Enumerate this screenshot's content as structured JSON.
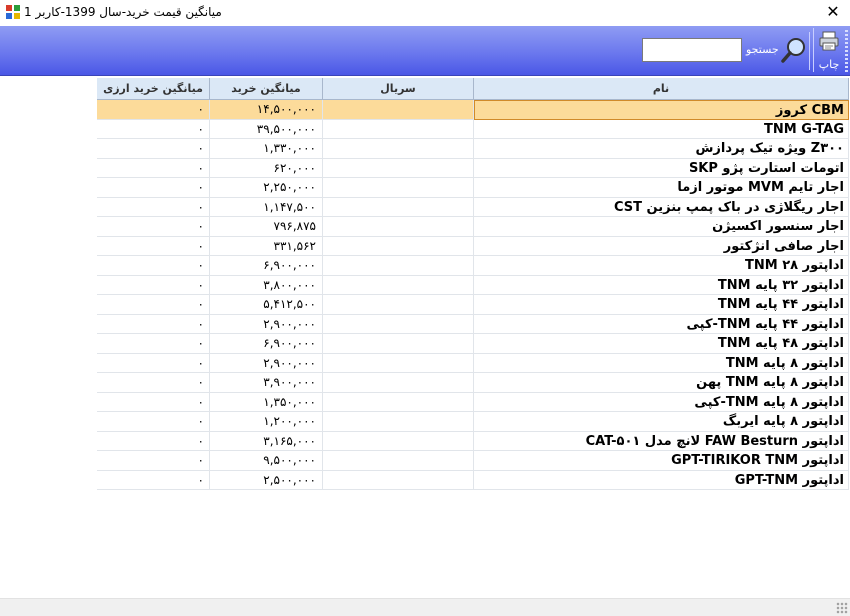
{
  "window": {
    "title": "میانگین قیمت خرید-سال 1399-کاربر 1",
    "close": "✕"
  },
  "toolbar": {
    "print_label": "چاپ",
    "search_label": "جستجو",
    "search_value": ""
  },
  "columns": {
    "name": "نام",
    "serial": "سریال",
    "avg_purchase": "میانگین خرید",
    "avg_fx": "میانگین خرید ارزی"
  },
  "rows": [
    {
      "name": "CBM کروز",
      "serial": "",
      "avg": "۱۴,۵۰۰,۰۰۰",
      "fx": "۰"
    },
    {
      "name": "TNM G-TAG",
      "serial": "",
      "avg": "۳۹,۵۰۰,۰۰۰",
      "fx": "۰"
    },
    {
      "name": "Z۳۰۰ ویژه تیک پردازش",
      "serial": "",
      "avg": "۱,۳۳۰,۰۰۰",
      "fx": "۰"
    },
    {
      "name": "اتومات استارت پژو SKP",
      "serial": "",
      "avg": "۶۲۰,۰۰۰",
      "fx": "۰"
    },
    {
      "name": "اجار تایم MVM موتور ازما",
      "serial": "",
      "avg": "۲,۲۵۰,۰۰۰",
      "fx": "۰"
    },
    {
      "name": "اجار ریگلاژی در باک پمپ بنزین CST",
      "serial": "",
      "avg": "۱,۱۴۷,۵۰۰",
      "fx": "۰"
    },
    {
      "name": "اجار سنسور اکسیژن",
      "serial": "",
      "avg": "۷۹۶,۸۷۵",
      "fx": "۰"
    },
    {
      "name": "اجار صافی انژکتور",
      "serial": "",
      "avg": "۳۳۱,۵۶۲",
      "fx": "۰"
    },
    {
      "name": "اداپتور ۲۸ TNM",
      "serial": "",
      "avg": "۶,۹۰۰,۰۰۰",
      "fx": "۰"
    },
    {
      "name": "اداپتور ۳۲ پایه TNM",
      "serial": "",
      "avg": "۳,۸۰۰,۰۰۰",
      "fx": "۰"
    },
    {
      "name": "اداپتور ۴۴ پایه TNM",
      "serial": "",
      "avg": "۵,۴۱۲,۵۰۰",
      "fx": "۰"
    },
    {
      "name": "اداپتور ۴۴ پایه TNM-کپی",
      "serial": "",
      "avg": "۲,۹۰۰,۰۰۰",
      "fx": "۰"
    },
    {
      "name": "اداپتور ۴۸ پایه TNM",
      "serial": "",
      "avg": "۶,۹۰۰,۰۰۰",
      "fx": "۰"
    },
    {
      "name": "اداپتور ۸ پایه TNM",
      "serial": "",
      "avg": "۲,۹۰۰,۰۰۰",
      "fx": "۰"
    },
    {
      "name": "اداپتور ۸ پایه TNM پهن",
      "serial": "",
      "avg": "۳,۹۰۰,۰۰۰",
      "fx": "۰"
    },
    {
      "name": "اداپتور ۸ پایه TNM-کپی",
      "serial": "",
      "avg": "۱,۳۵۰,۰۰۰",
      "fx": "۰"
    },
    {
      "name": "اداپتور ۸ پایه ایربگ",
      "serial": "",
      "avg": "۱,۲۰۰,۰۰۰",
      "fx": "۰"
    },
    {
      "name": "اداپتور FAW Besturn لانچ مدل CAT-۵۰۱",
      "serial": "",
      "avg": "۳,۱۶۵,۰۰۰",
      "fx": "۰"
    },
    {
      "name": "اداپتور GPT-TIRIKOR TNM",
      "serial": "",
      "avg": "۹,۵۰۰,۰۰۰",
      "fx": "۰"
    },
    {
      "name": "اداپتور GPT-TNM",
      "serial": "",
      "avg": "۲,۵۰۰,۰۰۰",
      "fx": "۰"
    }
  ],
  "selected_row": 0,
  "colors": {
    "toolbar_top": "#8f9cf3",
    "toolbar_bottom": "#4a57e6",
    "header_bg": "#dbe8f6",
    "selected_row": "#fcdb9a"
  }
}
